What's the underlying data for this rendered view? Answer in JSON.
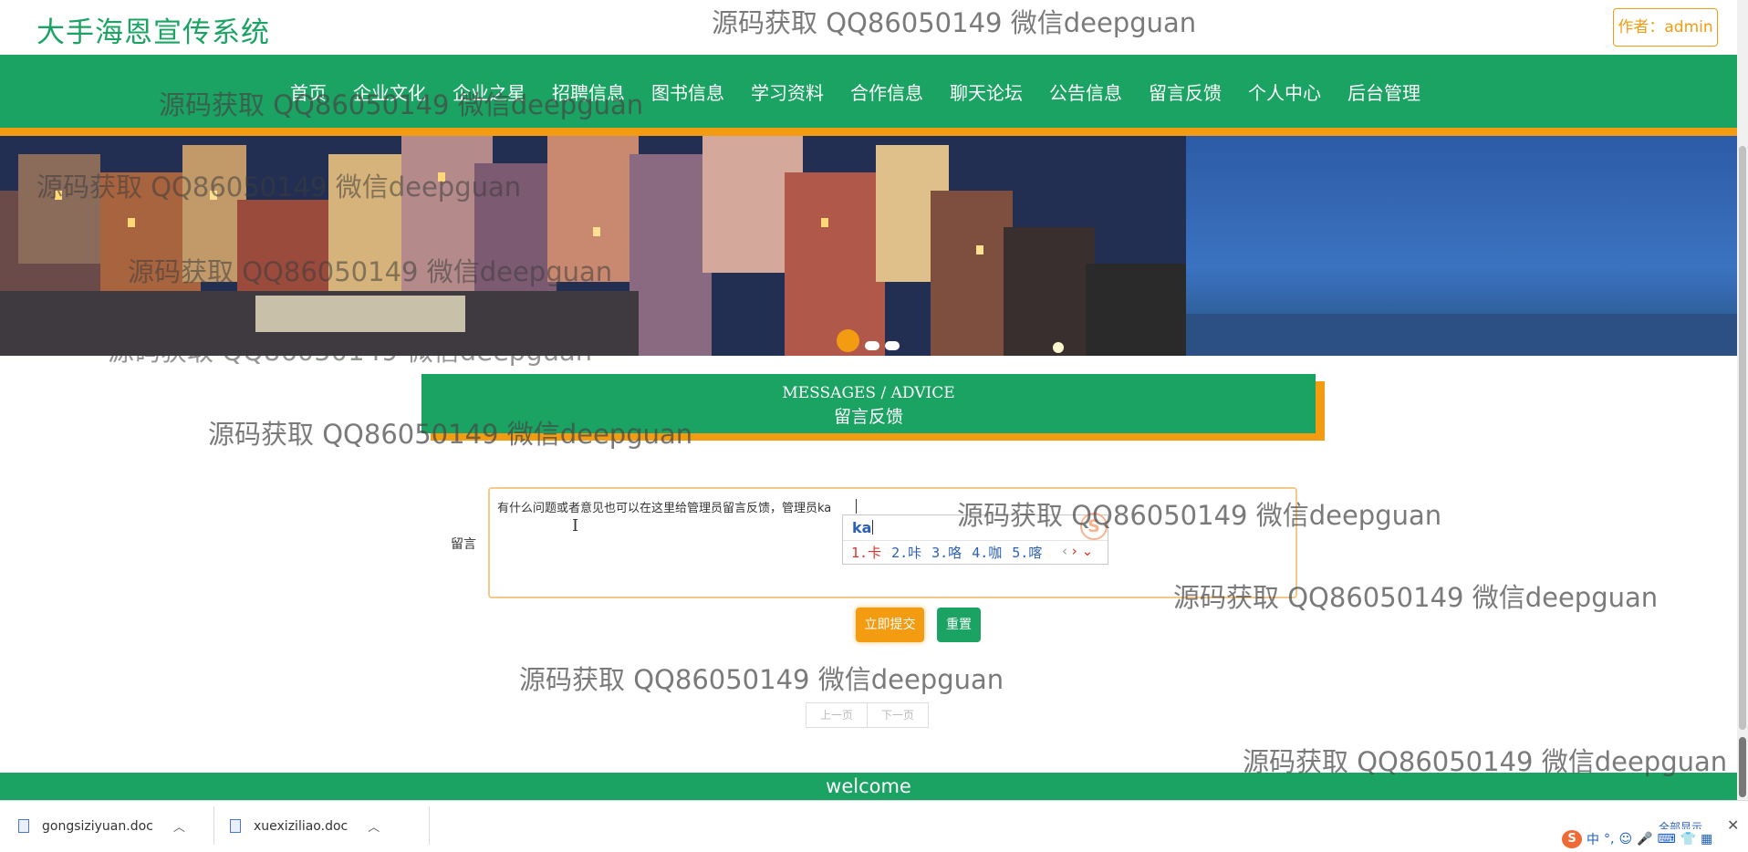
{
  "header": {
    "site_title": "大手海恩宣传系统",
    "author_label": "作者：admin"
  },
  "nav": {
    "items": [
      "首页",
      "企业文化",
      "企业之星",
      "招聘信息",
      "图书信息",
      "学习资料",
      "合作信息",
      "聊天论坛",
      "公告信息",
      "留言反馈",
      "个人中心",
      "后台管理"
    ]
  },
  "banner": {
    "slide_count": 3,
    "active_slide": 1
  },
  "section": {
    "title_en": "MESSAGES / ADVICE",
    "title_cn": "留言反馈"
  },
  "form": {
    "label": "留言",
    "message_value": "有什么问题或者意见也可以在这里给管理员留言反馈，管理员ka",
    "submit_label": "立即提交",
    "reset_label": "重置"
  },
  "ime": {
    "input": "ka",
    "candidates": [
      "1.卡",
      "2.咔",
      "3.咯",
      "4.咖",
      "5.喀"
    ],
    "prev_glyph": "‹",
    "next_glyph": "›",
    "expand_glyph": "⌄",
    "logo": "S"
  },
  "pagination": {
    "prev": "上一页",
    "next": "下一页"
  },
  "footer": {
    "text": "welcome"
  },
  "downloads": {
    "files": [
      "gongsiziyuan.doc",
      "xuexiziliao.doc"
    ],
    "show_all": "全部显示",
    "close": "✕"
  },
  "tray": {
    "logo": "S",
    "lang": "中"
  },
  "watermark": {
    "text": "源码获取 QQ86050149 微信deepguan"
  },
  "colors": {
    "primary": "#1aa362",
    "accent": "#f39c12"
  }
}
